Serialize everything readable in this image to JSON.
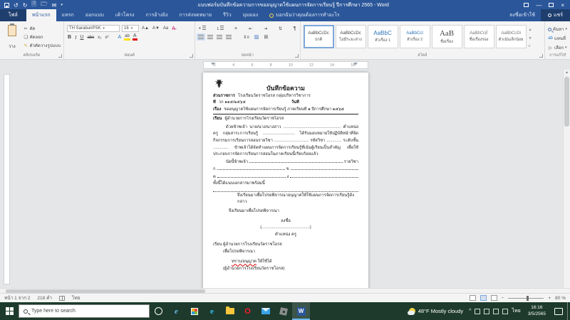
{
  "titlebar": {
    "title": "แบบฟอร์มบันทึกข้อความการขออนุญาตใช้แผนการจัดการเรียนรู้ ปีการศึกษา 2565 - Word",
    "signin": "ลงชื่อเข้าใช้",
    "share": "แชร์"
  },
  "tabs": {
    "file": "ไฟล์",
    "home": "หน้าแรก",
    "insert": "แทรก",
    "design": "ออกแบบ",
    "layout": "เค้าโครง",
    "references": "การอ้างอิง",
    "mailings": "การส่งจดหมาย",
    "review": "รีวิว",
    "view": "มุมมอง",
    "tellme": "บอกฉันว่าคุณต้องการทำอะไร"
  },
  "ribbon": {
    "clipboard": {
      "paste": "วาง",
      "cut": "ตัด",
      "copy": "คัดลอก",
      "format_painter": "ตัวคัดวางรูปแบบ",
      "label": "คลิปบอร์ด"
    },
    "font": {
      "name": "TH SarabunPSK",
      "size": "16",
      "bold": "B",
      "italic": "I",
      "underline": "U",
      "strike": "abc",
      "subscript": "x₂",
      "superscript": "x²",
      "effects": "A",
      "highlight": "ab",
      "color": "A",
      "grow": "A▲",
      "shrink": "A▼",
      "change_case": "Aa",
      "label": "ฟอนต์"
    },
    "paragraph": {
      "label": "ย่อหน้า",
      "pilcrow": "¶",
      "sort": "⇅",
      "bullets": "•",
      "numbering": "1.",
      "multilevel": "a:"
    },
    "styles": {
      "label": "สไตล์",
      "items": [
        {
          "sample": "AaBbCcDc",
          "name": "ปกติ"
        },
        {
          "sample": "AaBbCcDc",
          "name": "ไม่มีระยะห่าง"
        },
        {
          "sample": "AaBbC",
          "name": "หัวเรื่อง 1"
        },
        {
          "sample": "AaBbCcI",
          "name": "หัวเรื่อง 2"
        },
        {
          "sample": "AaB",
          "name": "ชื่อเรื่อง"
        },
        {
          "sample": "AaBbCcE",
          "name": "ชื่อเรื่องรอง"
        },
        {
          "sample": "AaBbCcDi",
          "name": "ตัวเน้นเล็กน้อย"
        }
      ]
    },
    "editing": {
      "find": "ค้นหา",
      "replace": "แทนที่",
      "select": "เลือก",
      "label": "การแก้ไข"
    }
  },
  "ruler": {
    "numbers": [
      "2",
      "4",
      "6",
      "8",
      "10",
      "12",
      "14",
      "16"
    ]
  },
  "document": {
    "memo_title": "บันทึกข้อความ",
    "agency_label": "ส่วนราชการ",
    "agency_value": "โรงเรียนวัดราชโอรส   กลุ่มบริหารวิชาการ",
    "no_label": "ที่",
    "no_value": "วก ๑๑๕/๒๕๖๕",
    "date_label": "วันที่",
    "subject_label": "เรื่อง",
    "subject_value": "ขออนุญาตใช้แผนการจัดการเรียนรู้ ภาคเรียนที่ ๑ ปีการศึกษา ๒๕๖๕",
    "to_label": "เรียน",
    "to_value": "ผู้อำนวยการโรงเรียนวัดราชโอรส",
    "body_paragraph": "ด้วยข้าพเจ้า นาย/นาง/นางสาว .................................................. ตำแหน่ง ครู กลุ่มสาระการเรียนรู้ ............................ ได้รับมอบหมายให้ปฏิบัติหน้าที่จัดกิจกรรมการเรียนการสอนรายวิชา .............................. รหัสวิชา ............. ระดับชั้น ............. ข้าพเจ้าได้จัดทำแผนการจัดการเรียนรู้ที่เน้นผู้เรียนเป็นสำคัญ เพื่อใช้ประกอบการจัดการเรียนการสอนในภาคเรียนนี้เรียบร้อยแล้ว",
    "fill1_prefix": "บัดนี้ข้าพเจ้า",
    "fill1_suffix": "รายวิชา",
    "fill2_left": "ก",
    "fill2_mid": "ข",
    "fill3_left": "ค",
    "fill3_mid": "ง",
    "note_line": "ทั้งนี้ได้แนบเอกสารมาพร้อมนี้",
    "closing_note": "จึงเรียนมาเพื่อโปรดพิจารณาอนุญาตให้ใช้แผนการจัดการเรียนรู้ดังกล่าว",
    "please_line": "จึงเรียนมาเพื่อโปรดพิจารณา",
    "sign_label": "ลงชื่อ",
    "sign_paren": "(..........................................)",
    "sign_position": "ตำแหน่ง ครู",
    "bottom_to": "เรียน ผู้อำนวยการโรงเรียนวัดราชโอรส",
    "bottom_consider": "เพื่อโปรดพิจารณา",
    "approval_red": "ทราบ/อนุญาต",
    "approval_rest": "ให้ใช้ได้",
    "director_paren": "(ผู้อำนวยการโรงเรียนวัดราชโอรส)"
  },
  "statusbar": {
    "page": "หน้า 1 จาก 2",
    "words": "218 คำ",
    "language": "ไทย",
    "zoom": "80 %"
  },
  "taskbar": {
    "search_placeholder": "Type here to search",
    "word_initial": "W",
    "weather": "48°F Mostly cloudy",
    "tray_chevron": "^",
    "language": "ไทย",
    "time": "16:16",
    "date": "3/5/2565"
  },
  "colors": {
    "accent_blue": "#2b579a",
    "taskbar_green": "#1d3a2c",
    "highlight_yellow": "#ffe100",
    "font_red": "#e00000"
  }
}
